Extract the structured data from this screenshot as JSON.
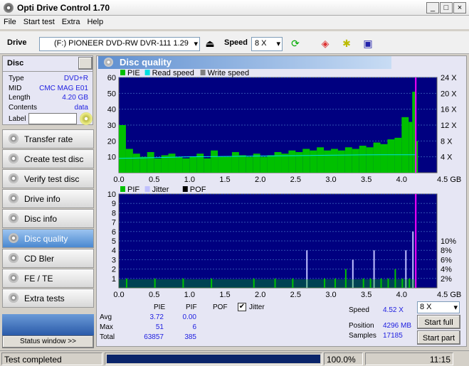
{
  "window": {
    "title": "Opti Drive Control 1.70"
  },
  "menu": [
    "File",
    "Start test",
    "Extra",
    "Help"
  ],
  "toolbar": {
    "drive_label": "Drive",
    "drive_value": "(F:)  PIONEER DVD-RW  DVR-111 1.29",
    "speed_label": "Speed",
    "speed_value": "8 X"
  },
  "disc": {
    "header": "Disc",
    "type_label": "Type",
    "type": "DVD+R",
    "mid_label": "MID",
    "mid": "CMC MAG E01",
    "length_label": "Length",
    "length": "4.20 GB",
    "contents_label": "Contents",
    "contents": "data",
    "label_label": "Label",
    "label_value": ""
  },
  "nav": [
    {
      "label": "Transfer rate"
    },
    {
      "label": "Create test disc"
    },
    {
      "label": "Verify test disc"
    },
    {
      "label": "Drive info"
    },
    {
      "label": "Disc info"
    },
    {
      "label": "Disc quality",
      "active": true
    },
    {
      "label": "CD Bler"
    },
    {
      "label": "FE / TE"
    },
    {
      "label": "Extra tests"
    }
  ],
  "status_window": "Status window >>",
  "panel": {
    "title": "Disc quality"
  },
  "colors": {
    "pie": "#00c000",
    "read_speed": "#00e0e0",
    "pif": "#00c000",
    "jitter": "#c0c0ff",
    "plot_bg": "#000080",
    "end_marker": "#ff00ff"
  },
  "chart_data": [
    {
      "type": "bar",
      "legend": [
        "PIE",
        "Read speed",
        "Write speed"
      ],
      "x_ticks": [
        "0.0",
        "0.5",
        "1.0",
        "1.5",
        "2.0",
        "2.5",
        "3.0",
        "3.5",
        "4.0",
        "4.5 GB"
      ],
      "xlim": [
        0,
        4.5
      ],
      "ylim": [
        0,
        60
      ],
      "y_ticks": [
        "10",
        "20",
        "30",
        "40",
        "50",
        "60"
      ],
      "y2_ticks": [
        "4 X",
        "8 X",
        "12 X",
        "16 X",
        "20 X",
        "24 X"
      ],
      "y2lim": [
        0,
        24
      ],
      "end_marker": 4.2,
      "x": [
        0,
        0.1,
        0.2,
        0.3,
        0.4,
        0.5,
        0.6,
        0.7,
        0.8,
        0.9,
        1.0,
        1.1,
        1.2,
        1.3,
        1.4,
        1.5,
        1.6,
        1.7,
        1.8,
        1.9,
        2.0,
        2.1,
        2.2,
        2.3,
        2.4,
        2.5,
        2.6,
        2.7,
        2.8,
        2.9,
        3.0,
        3.1,
        3.2,
        3.3,
        3.4,
        3.5,
        3.6,
        3.7,
        3.8,
        3.9,
        4.0,
        4.1,
        4.15,
        4.2
      ],
      "pie": [
        30,
        15,
        12,
        10,
        13,
        9,
        11,
        12,
        10,
        9,
        10,
        12,
        9,
        14,
        10,
        10,
        13,
        11,
        10,
        12,
        10,
        11,
        13,
        12,
        14,
        13,
        15,
        14,
        16,
        14,
        15,
        14,
        16,
        15,
        17,
        16,
        19,
        18,
        21,
        22,
        35,
        32,
        51,
        20
      ],
      "read_speed_x": [
        3.6,
        3.7,
        3.8,
        3.9,
        4.0,
        4.05,
        4.1,
        4.15,
        4.2,
        4.25,
        4.3,
        4.35,
        4.4,
        4.45,
        4.5,
        4.52,
        4.52,
        4.52
      ]
    },
    {
      "type": "bar",
      "legend": [
        "PIF",
        "Jitter",
        "POF"
      ],
      "x_ticks": [
        "0.0",
        "0.5",
        "1.0",
        "1.5",
        "2.0",
        "2.5",
        "3.0",
        "3.5",
        "4.0",
        "4.5 GB"
      ],
      "xlim": [
        0,
        4.5
      ],
      "ylim": [
        0,
        10
      ],
      "y_ticks": [
        "1",
        "2",
        "3",
        "4",
        "5",
        "6",
        "7",
        "8",
        "9",
        "10"
      ],
      "y2_ticks": [
        "2%",
        "4%",
        "6%",
        "8%",
        "10%"
      ],
      "end_marker": 4.2,
      "x": [
        0.1,
        0.5,
        0.9,
        1.3,
        1.9,
        2.2,
        2.45,
        2.65,
        2.9,
        3.05,
        3.2,
        3.3,
        3.45,
        3.55,
        3.6,
        3.7,
        3.8,
        3.9,
        4.0,
        4.05,
        4.1,
        4.15
      ],
      "pif": [
        1,
        1,
        1,
        1,
        1,
        1,
        1,
        4,
        1,
        1,
        2,
        3,
        1,
        1,
        4,
        1,
        1,
        2,
        1,
        4,
        1,
        6
      ]
    }
  ],
  "stats": {
    "cols": [
      "PIE",
      "PIF",
      "POF"
    ],
    "jitter_label": "Jitter",
    "jitter_checked": true,
    "rows": [
      {
        "label": "Avg",
        "pie": "3.72",
        "pif": "0.00"
      },
      {
        "label": "Max",
        "pie": "51",
        "pif": "6"
      },
      {
        "label": "Total",
        "pie": "63857",
        "pif": "385"
      }
    ]
  },
  "info": {
    "speed_label": "Speed",
    "speed": "4.52 X",
    "position_label": "Position",
    "position": "4296 MB",
    "samples_label": "Samples",
    "samples": "17185",
    "speed_select": "8 X",
    "start_full": "Start full",
    "start_part": "Start part"
  },
  "status": {
    "text": "Test completed",
    "progress": 100,
    "percent": "100.0%",
    "time": "11:15"
  }
}
